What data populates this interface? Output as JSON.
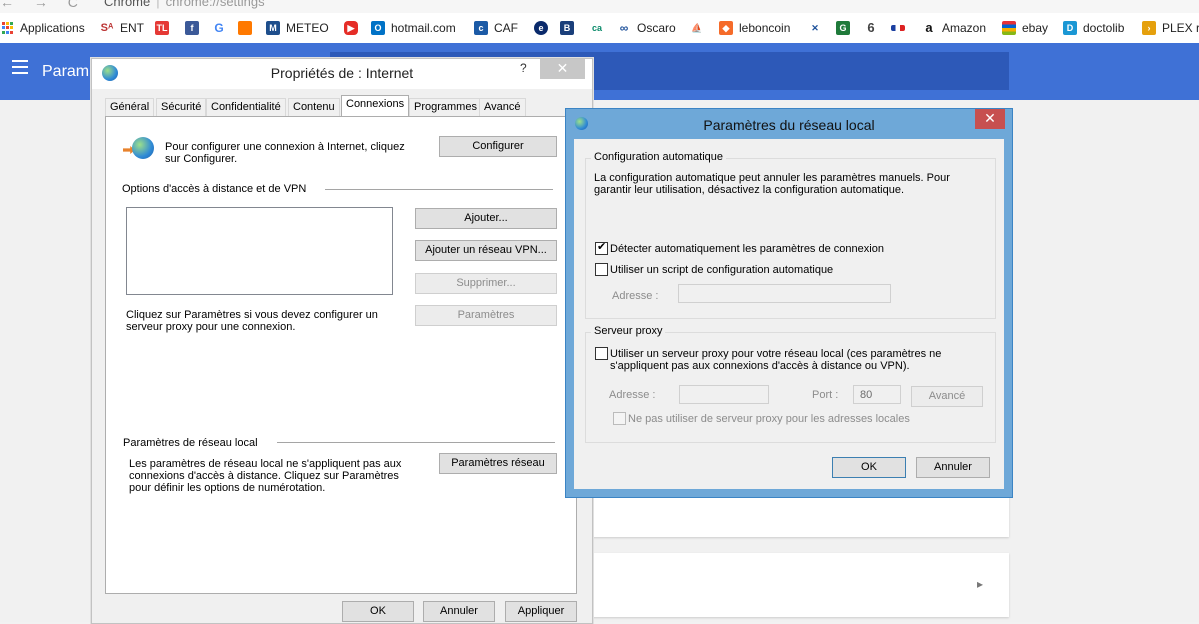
{
  "browser": {
    "app_name": "Chrome",
    "url": "chrome://settings",
    "bookmarks": [
      {
        "label": "Applications",
        "icon": "apps-grid-icon"
      },
      {
        "label": "ENT",
        "icon": "ent-icon"
      },
      {
        "label": "",
        "icon": "tl-icon"
      },
      {
        "label": "",
        "icon": "facebook-icon"
      },
      {
        "label": "",
        "icon": "google-icon"
      },
      {
        "label": "",
        "icon": "orange-icon"
      },
      {
        "label": "METEO",
        "icon": "meteo-icon"
      },
      {
        "label": "",
        "icon": "youtube-icon"
      },
      {
        "label": "hotmail.com",
        "icon": "outlook-icon"
      },
      {
        "label": "CAF",
        "icon": "caf-icon"
      },
      {
        "label": "",
        "icon": "globe-e-icon"
      },
      {
        "label": "",
        "icon": "bank-icon"
      },
      {
        "label": "",
        "icon": "credit-agricole-icon"
      },
      {
        "label": "Oscaro",
        "icon": "oscaro-icon"
      },
      {
        "label": "",
        "icon": "ship-icon"
      },
      {
        "label": "leboncoin",
        "icon": "leboncoin-icon"
      },
      {
        "label": "",
        "icon": "cross-icon"
      },
      {
        "label": "",
        "icon": "g-green-icon"
      },
      {
        "label": "",
        "icon": "six-icon"
      },
      {
        "label": "",
        "icon": "flag-icon"
      },
      {
        "label": "Amazon",
        "icon": "amazon-icon"
      },
      {
        "label": "ebay",
        "icon": "ebay-icon"
      },
      {
        "label": "doctolib",
        "icon": "doctolib-icon"
      },
      {
        "label": "PLEX r",
        "icon": "plex-icon"
      }
    ]
  },
  "settings_header": {
    "title": "Param"
  },
  "internet_properties": {
    "title": "Propriétés de : Internet",
    "help": "?",
    "close": "✕",
    "tabs": [
      "Général",
      "Sécurité",
      "Confidentialité",
      "Contenu",
      "Connexions",
      "Programmes",
      "Avancé"
    ],
    "active_tab": "Connexions",
    "setup_text": "Pour configurer une connexion à Internet, cliquez sur Configurer.",
    "configure_button": "Configurer",
    "dialup_section": "Options d'accès à distance et de VPN",
    "add_button": "Ajouter...",
    "add_vpn_button": "Ajouter un réseau VPN...",
    "remove_button": "Supprimer...",
    "settings_button": "Paramètres",
    "proxy_hint": "Cliquez sur Paramètres si vous devez configurer un serveur proxy pour une connexion.",
    "lan_section": "Paramètres de réseau local",
    "lan_text": "Les paramètres de réseau local ne s'appliquent pas aux connexions d'accès à distance. Cliquez sur Paramètres pour définir les options de numérotation.",
    "lan_button": "Paramètres réseau",
    "ok_button": "OK",
    "cancel_button": "Annuler",
    "apply_button": "Appliquer"
  },
  "lan_settings": {
    "title": "Paramètres du réseau local",
    "close": "✕",
    "auto_group": "Configuration automatique",
    "auto_desc": "La configuration automatique peut annuler les paramètres manuels. Pour garantir leur utilisation, désactivez la configuration automatique.",
    "auto_detect_label": "Détecter automatiquement les paramètres de connexion",
    "auto_detect_checked": true,
    "script_label": "Utiliser un script de configuration automatique",
    "script_checked": false,
    "address_label": "Adresse :",
    "address_value": "",
    "proxy_group": "Serveur proxy",
    "proxy_label": "Utiliser un serveur proxy pour votre réseau local (ces paramètres ne s'appliquent pas aux connexions d'accès à distance ou VPN).",
    "proxy_checked": false,
    "proxy_address_label": "Adresse :",
    "proxy_address_value": "",
    "port_label": "Port :",
    "port_value": "80",
    "advanced_button": "Avancé",
    "bypass_label": "Ne pas utiliser de serveur proxy pour les adresses locales",
    "bypass_checked": false,
    "ok_button": "OK",
    "cancel_button": "Annuler"
  }
}
